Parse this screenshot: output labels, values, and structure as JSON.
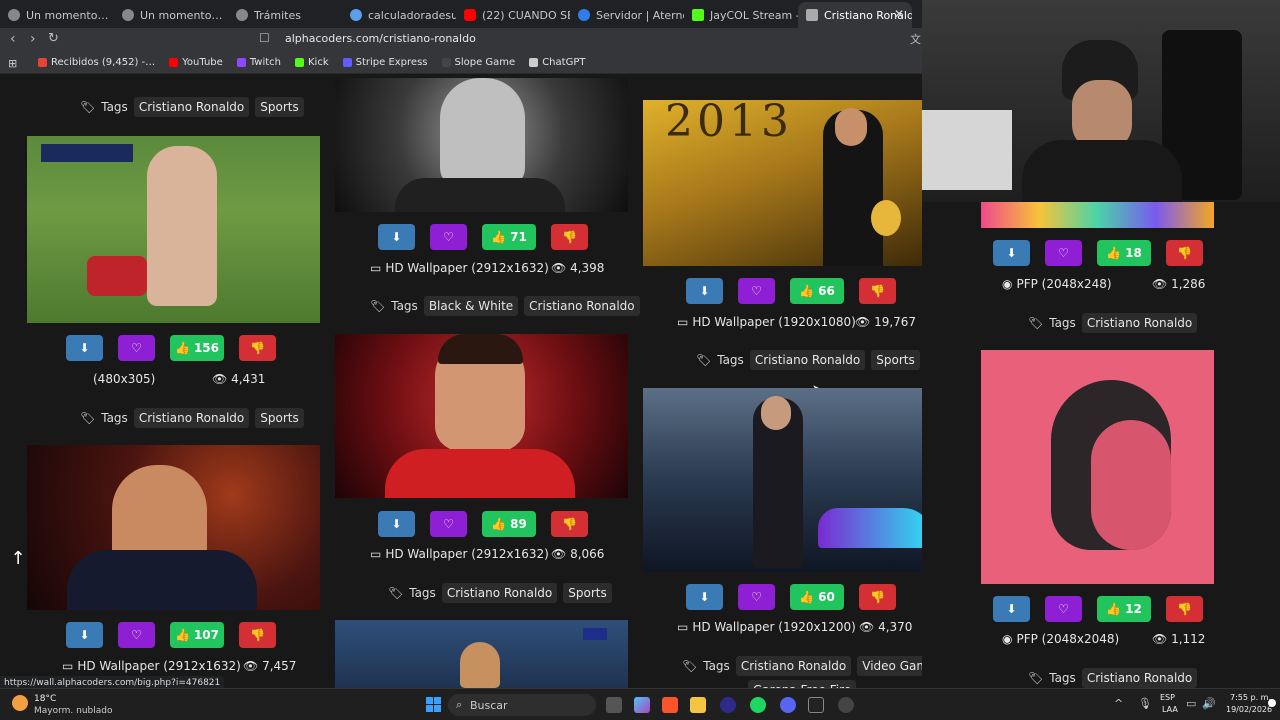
{
  "browser": {
    "tabs": [
      {
        "title": "Un momento…",
        "active": false
      },
      {
        "title": "Un momento…",
        "active": false
      },
      {
        "title": "Trámites",
        "active": false
      },
      {
        "title": "calculadoradesueno.co",
        "active": false
      },
      {
        "title": "(22) CUANDO SE A…",
        "active": false
      },
      {
        "title": "Servidor | Aternos | Ser",
        "active": false
      },
      {
        "title": "JayCOL Stream - Watch",
        "active": false
      },
      {
        "title": "Cristiano Ronaldo",
        "active": true
      }
    ],
    "url": "alphacoders.com/cristiano-ronaldo",
    "bookmarks": [
      {
        "label": "Recibidos (9,452) -…",
        "color": "#ea4335"
      },
      {
        "label": "YouTube",
        "color": "#ff0000"
      },
      {
        "label": "Twitch",
        "color": "#9146ff"
      },
      {
        "label": "Kick",
        "color": "#53fc18"
      },
      {
        "label": "Stripe Express",
        "color": "#635bff"
      },
      {
        "label": "Slope Game",
        "color": "#444444"
      },
      {
        "label": "ChatGPT",
        "color": "#cccccc"
      }
    ],
    "status_url": "https://wall.alphacoders.com/big.php?i=476821"
  },
  "labels": {
    "tags": "Tags"
  },
  "cards": {
    "c1": {
      "resolution": "(480x305)",
      "likes": "156",
      "views": "4,431",
      "tags": [
        "Cristiano Ronaldo",
        "Sports"
      ]
    },
    "c1top": {
      "tags": [
        "Cristiano Ronaldo",
        "Sports"
      ]
    },
    "c2": {
      "resolution": "HD Wallpaper (2912x1632)",
      "likes": "107",
      "views": "7,457"
    },
    "c3": {
      "resolution": "HD Wallpaper (2912x1632)",
      "likes": "71",
      "views": "4,398",
      "tags": [
        "Black & White",
        "Cristiano Ronaldo"
      ]
    },
    "c4": {
      "resolution": "HD Wallpaper (2912x1632)",
      "likes": "89",
      "views": "8,066",
      "tags": [
        "Cristiano Ronaldo",
        "Sports"
      ]
    },
    "c5": {
      "resolution": "HD Wallpaper (1920x1080)",
      "likes": "66",
      "views": "19,767",
      "tags": [
        "Cristiano Ronaldo",
        "Sports"
      ],
      "image_text": "2013"
    },
    "c6": {
      "resolution": "HD Wallpaper (1920x1200)",
      "likes": "60",
      "views": "4,370",
      "tags": [
        "Cristiano Ronaldo",
        "Video Game"
      ],
      "extra_tag": "Garena Free Fire"
    },
    "c7": {
      "resolution": "PFP (2048x248)",
      "likes": "18",
      "views": "1,286",
      "tags": [
        "Cristiano Ronaldo"
      ]
    },
    "c8": {
      "resolution": "PFP (2048x2048)",
      "likes": "12",
      "views": "1,112",
      "tags": [
        "Cristiano Ronaldo"
      ]
    }
  },
  "taskbar": {
    "weather_temp": "18°C",
    "weather_desc": "Mayorm. nublado",
    "search_placeholder": "Buscar",
    "lang_line1": "ESP",
    "lang_line2": "LAA",
    "time": "7:55 p. m.",
    "date": "19/02/2026"
  }
}
